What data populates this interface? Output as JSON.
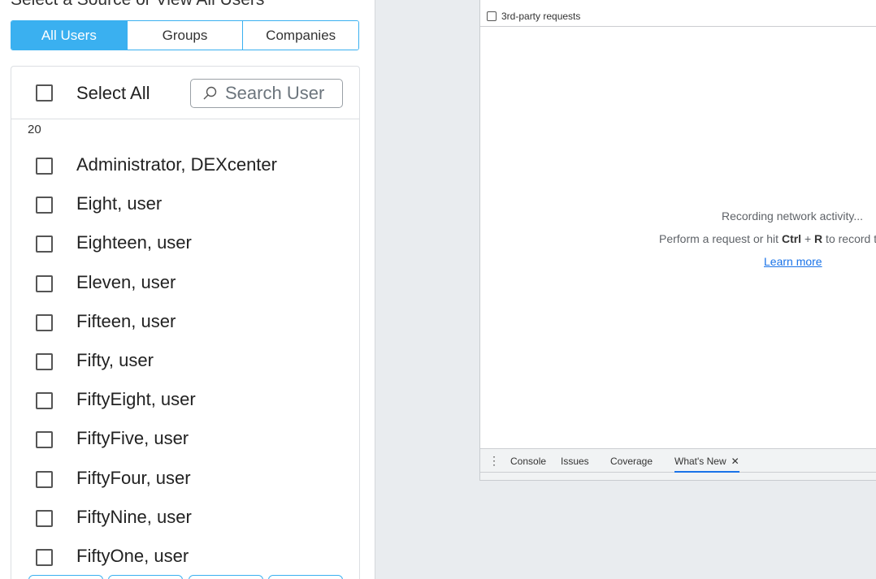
{
  "left": {
    "heading": "Select a Source or View All Users",
    "segments": [
      "All Users",
      "Groups",
      "Companies"
    ],
    "active_segment": "All Users",
    "select_all_label": "Select All",
    "search_placeholder": "Search User",
    "count": "20",
    "users": [
      "Administrator, DEXcenter",
      "Eight, user",
      "Eighteen, user",
      "Eleven, user",
      "Fifteen, user",
      "Fifty, user",
      "FiftyEight, user",
      "FiftyFive, user",
      "FiftyFour, user",
      "FiftyNine, user",
      "FiftyOne, user"
    ],
    "accent_color": "#3ab0f0"
  },
  "devtools": {
    "third_party_label": "3rd-party requests",
    "recording_msg": "Recording network activity...",
    "perform_msg_prefix": "Perform a request or hit ",
    "ctrl": "Ctrl",
    "plus": " + ",
    "r": "R",
    "perform_msg_suffix": " to record t",
    "learn_more": "Learn more",
    "drawer_tabs": [
      "Console",
      "Issues",
      "Coverage",
      "What's New"
    ],
    "active_tab": "What's New",
    "close_glyph": "✕",
    "menu_glyph": "⋮"
  }
}
